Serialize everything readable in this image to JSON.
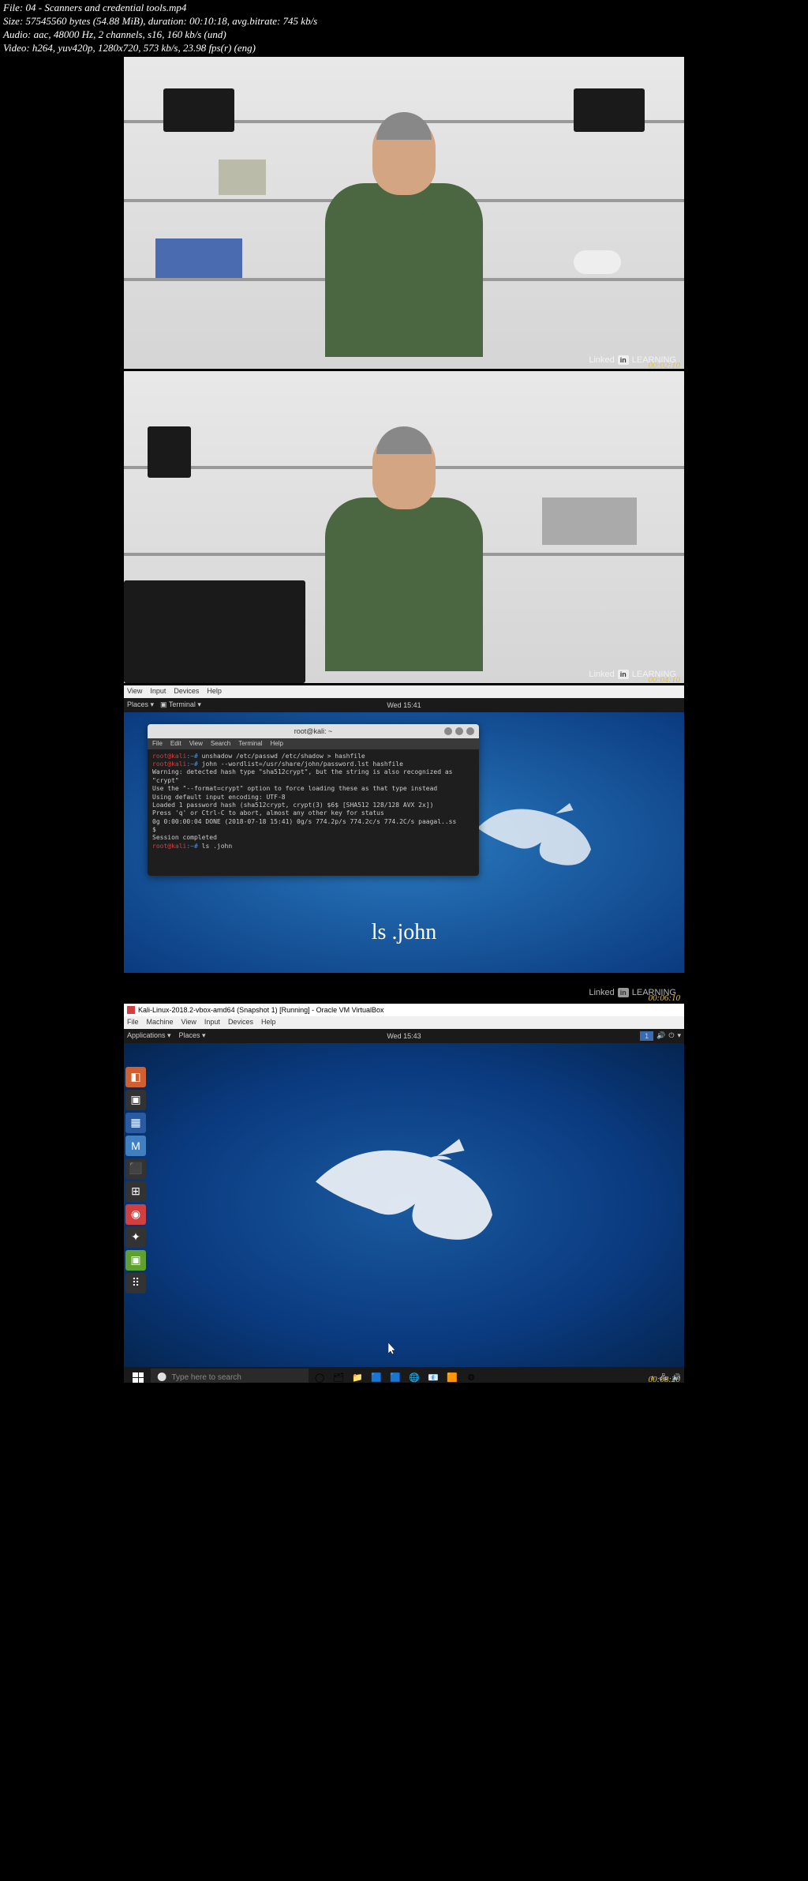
{
  "meta": {
    "file": "File: 04 - Scanners and credential tools.mp4",
    "size": "Size: 57545560 bytes (54.88 MiB), duration: 00:10:18, avg.bitrate: 745 kb/s",
    "audio": "Audio: aac, 48000 Hz, 2 channels, s16, 160 kb/s (und)",
    "video": "Video: h264, yuv420p, 1280x720, 573 kb/s, 23.98 fps(r) (eng)"
  },
  "watermark": {
    "linked": "Linked",
    "in": "in",
    "learning": "LEARNING"
  },
  "timestamps": {
    "f1": "00:02:10",
    "f2": "00:04:10",
    "f3": "00:06:10",
    "f4": "00:08:20"
  },
  "frame3": {
    "vb_menu": [
      "View",
      "Input",
      "Devices",
      "Help"
    ],
    "kali_places": "Places ▾",
    "kali_terminal": "Terminal ▾",
    "kali_time": "Wed 15:41",
    "term_title": "root@kali: ~",
    "term_menu": [
      "File",
      "Edit",
      "View",
      "Search",
      "Terminal",
      "Help"
    ],
    "term_lines": [
      {
        "p": "root@kali",
        "h": ":~#",
        "t": " unshadow /etc/passwd /etc/shadow > hashfile"
      },
      {
        "p": "root@kali",
        "h": ":~#",
        "t": " john --wordlist=/usr/share/john/password.lst hashfile"
      },
      {
        "t": "Warning: detected hash type \"sha512crypt\", but the string is also recognized as \"crypt\""
      },
      {
        "t": "Use the \"--format=crypt\" option to force loading these as that type instead"
      },
      {
        "t": "Using default input encoding: UTF-8"
      },
      {
        "t": "Loaded 1 password hash (sha512crypt, crypt(3) $6$ [SHA512 128/128 AVX 2x])"
      },
      {
        "t": "Press 'q' or Ctrl-C to abort, almost any other key for status"
      },
      {
        "t": "0g 0:00:00:04 DONE (2018-07-18 15:41) 0g/s 774.2p/s 774.2c/s 774.2C/s paagal..ss"
      },
      {
        "t": "$"
      },
      {
        "t": "Session completed"
      },
      {
        "p": "root@kali",
        "h": ":~#",
        "t": " ls .john"
      }
    ],
    "subtitle": "ls .john"
  },
  "frame4": {
    "vb_title": "Kali-Linux-2018.2-vbox-amd64 (Snapshot 1) [Running] - Oracle VM VirtualBox",
    "vb_menu": [
      "File",
      "Machine",
      "View",
      "Input",
      "Devices",
      "Help"
    ],
    "kali_apps": "Applications ▾",
    "kali_places": "Places ▾",
    "kali_time": "Wed 15:43",
    "tray_num": "1",
    "dock": [
      {
        "c": "#d06030",
        "g": "◧"
      },
      {
        "c": "#333",
        "g": "▣"
      },
      {
        "c": "#2a5aa0",
        "g": "▦"
      },
      {
        "c": "#4080c0",
        "g": "M"
      },
      {
        "c": "#333",
        "g": "⬛"
      },
      {
        "c": "#333",
        "g": "⊞"
      },
      {
        "c": "#d04040",
        "g": "◉"
      },
      {
        "c": "#333",
        "g": "✦"
      },
      {
        "c": "#60a030",
        "g": "▣"
      },
      {
        "c": "#333",
        "g": "⠿"
      }
    ],
    "taskbar": {
      "search_placeholder": "Type here to search",
      "icons": [
        "◯",
        "🗂",
        "📁",
        "🟦",
        "🟦",
        "🌐",
        "📧",
        "🟧",
        "⚙"
      ]
    }
  }
}
